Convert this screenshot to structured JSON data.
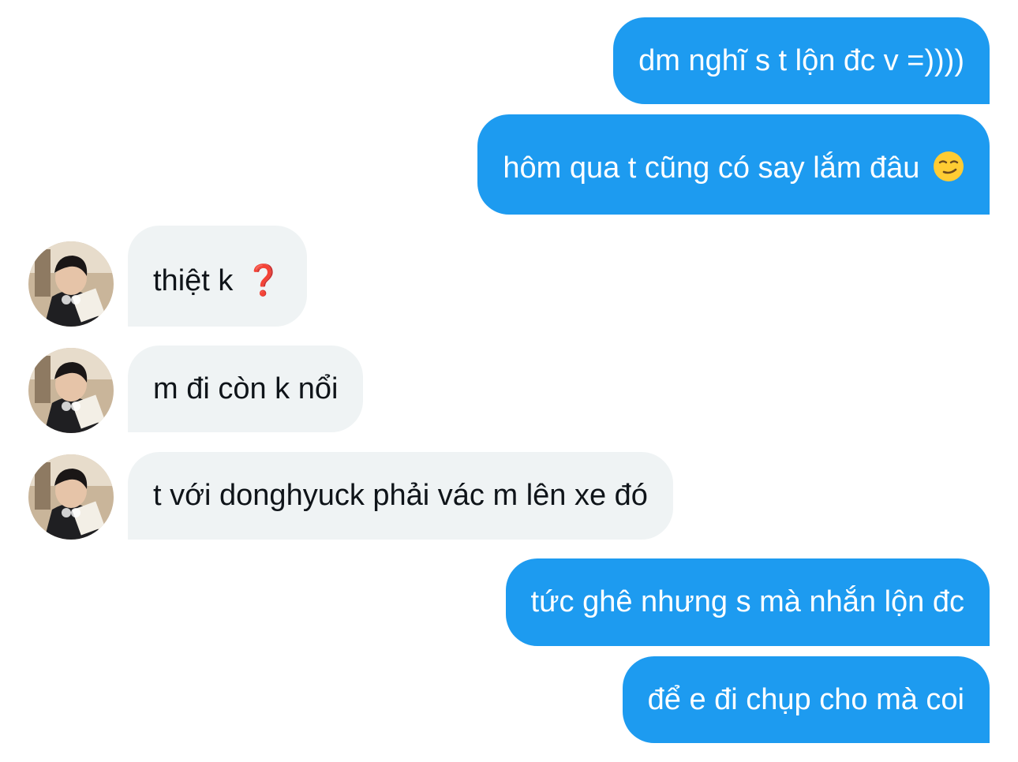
{
  "messages": [
    {
      "direction": "sent",
      "text": "dm nghĩ s t lộn đc v =))))"
    },
    {
      "direction": "sent",
      "text": "hôm qua t cũng có say lắm đâu",
      "emoji": "smirk-emoji"
    },
    {
      "direction": "received",
      "text": "thiệt k",
      "emoji_text": "❓",
      "avatar": "profile-avatar"
    },
    {
      "direction": "received",
      "text": "m đi còn k nổi",
      "avatar": "profile-avatar"
    },
    {
      "direction": "received",
      "text": "t với donghyuck phải vác m lên xe đó",
      "avatar": "profile-avatar"
    },
    {
      "direction": "sent",
      "text": "tức ghê nhưng s mà nhắn lộn đc"
    },
    {
      "direction": "sent",
      "text": "để e đi chụp cho mà coi"
    }
  ],
  "colors": {
    "sent_bubble": "#1d9bf0",
    "received_bubble": "#eff3f4",
    "sent_text": "#ffffff",
    "received_text": "#0f1419"
  }
}
